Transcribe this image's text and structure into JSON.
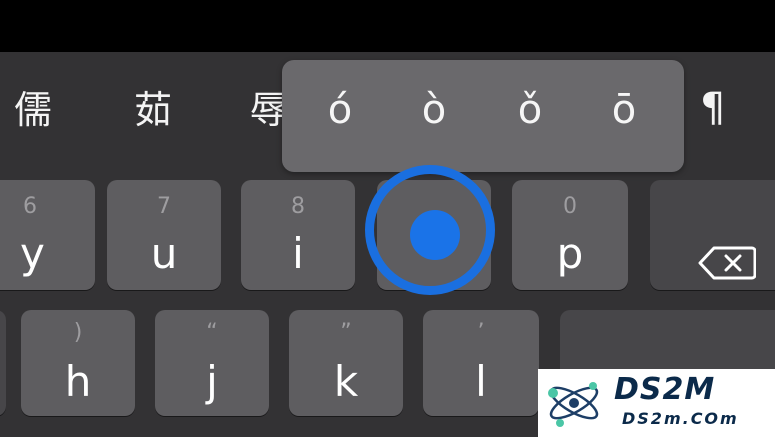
{
  "candidates": [
    "儒",
    "茹",
    "辱"
  ],
  "pilcrow": "¶",
  "accent_popup": {
    "options": [
      "ó",
      "ò",
      "ǒ",
      "ō"
    ]
  },
  "keys_row1": [
    {
      "hint": "6",
      "main": "y"
    },
    {
      "hint": "7",
      "main": "u"
    },
    {
      "hint": "8",
      "main": "i"
    },
    {
      "hint": "0",
      "main": "p"
    }
  ],
  "keys_row2": [
    {
      "hint": ")",
      "main": "h"
    },
    {
      "hint": "“",
      "main": "j"
    },
    {
      "hint": "”",
      "main": "k"
    },
    {
      "hint": "’",
      "main": "l"
    }
  ],
  "watermark": {
    "title": "DS2M",
    "subtitle": "DS2m.COm"
  },
  "colors": {
    "touch_indicator": "#1a73e8",
    "keyboard_bg": "#333234",
    "key_bg": "#5e5d60",
    "popup_bg": "#6a696c"
  }
}
